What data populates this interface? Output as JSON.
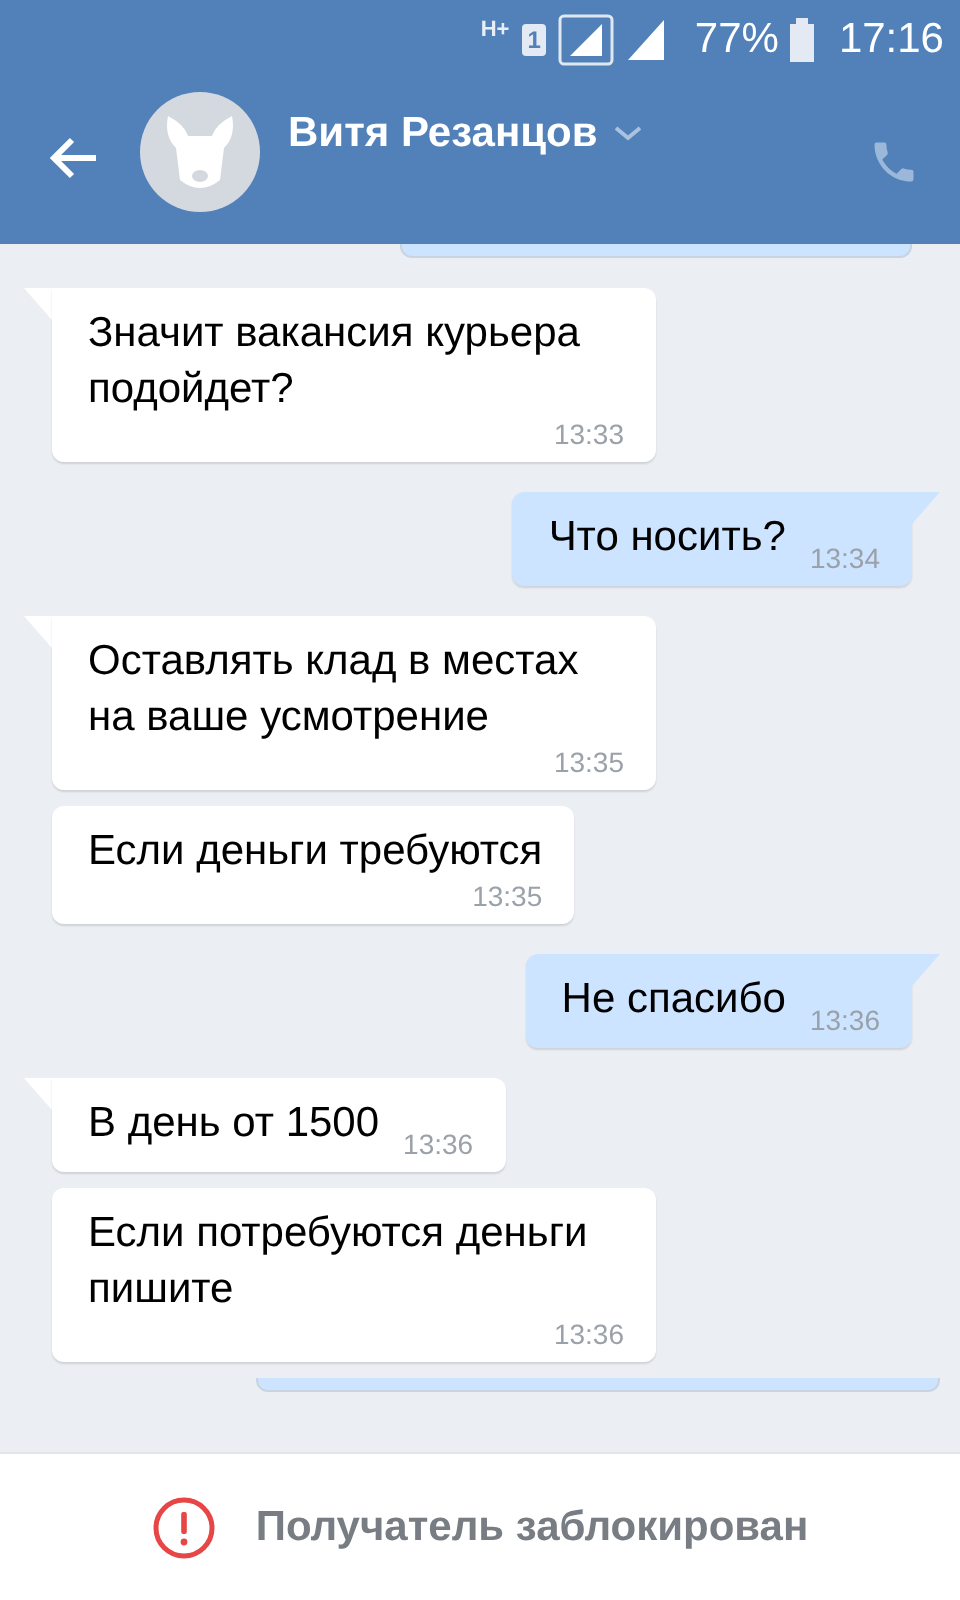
{
  "status_bar": {
    "network": "H+",
    "sim": "1",
    "battery": "77%",
    "time": "17:16"
  },
  "header": {
    "contact_name": "Витя Резанцов"
  },
  "messages": [
    {
      "kind": "partial",
      "outgoing": true
    },
    {
      "kind": "message",
      "outgoing": false,
      "first": true,
      "text": "Значит вакансия курьера подойдет?",
      "time": "13:33",
      "time_inline": false
    },
    {
      "kind": "message",
      "outgoing": true,
      "first": true,
      "text": "Что носить?",
      "time": "13:34",
      "time_inline": true
    },
    {
      "kind": "message",
      "outgoing": false,
      "first": true,
      "text": "Оставлять клад в местах на ваше усмотрение",
      "time": "13:35",
      "time_inline": false
    },
    {
      "kind": "message",
      "outgoing": false,
      "first": false,
      "text": "Если деньги требуются",
      "time": "13:35",
      "time_inline": false
    },
    {
      "kind": "message",
      "outgoing": true,
      "first": true,
      "text": "Не спасибо",
      "time": "13:36",
      "time_inline": true
    },
    {
      "kind": "message",
      "outgoing": false,
      "first": true,
      "text": "В день от 1500",
      "time": "13:36",
      "time_inline": true
    },
    {
      "kind": "message",
      "outgoing": false,
      "first": false,
      "text": "Если потребуются деньги пишите",
      "time": "13:36",
      "time_inline": false
    },
    {
      "kind": "partial",
      "outgoing": true
    }
  ],
  "footer": {
    "notice": "Получатель заблокирован"
  }
}
